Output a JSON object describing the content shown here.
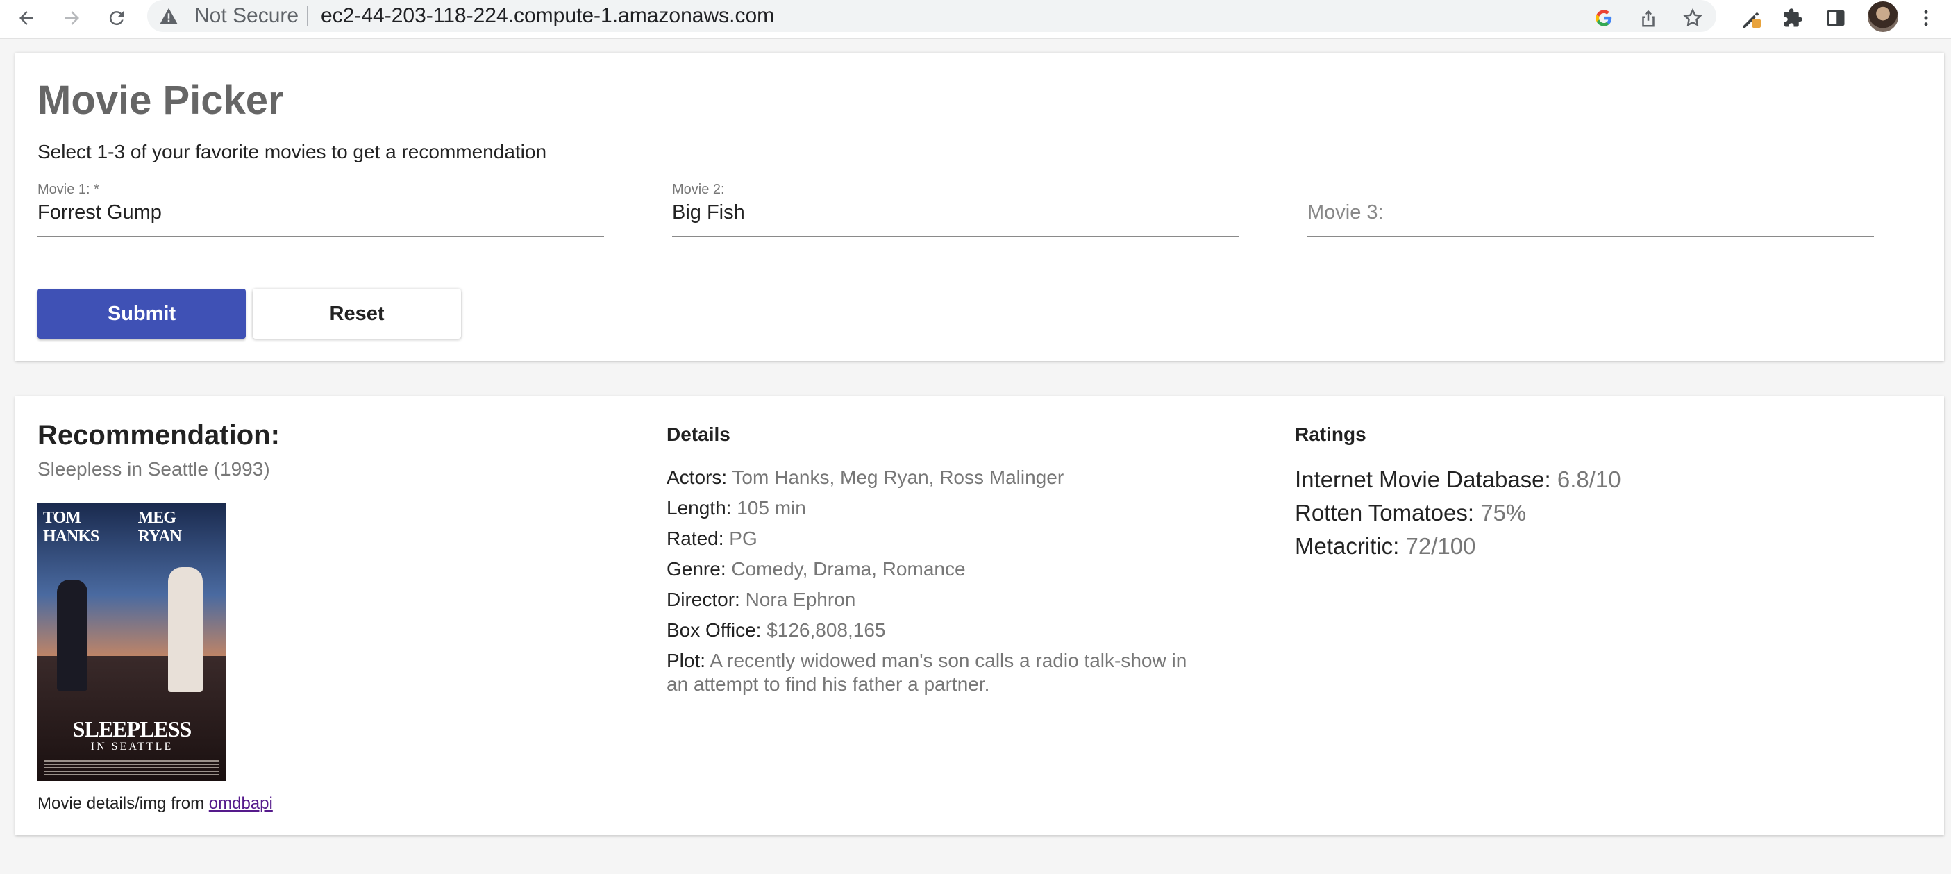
{
  "browser": {
    "security_label": "Not Secure",
    "url": "ec2-44-203-118-224.compute-1.amazonaws.com"
  },
  "form": {
    "title": "Movie Picker",
    "subtitle": "Select 1-3 of your favorite movies to get a recommendation",
    "fields": [
      {
        "label": "Movie 1:  *",
        "value": "Forrest Gump",
        "placeholder": ""
      },
      {
        "label": "Movie 2:",
        "value": "Big Fish",
        "placeholder": ""
      },
      {
        "label": "",
        "value": "",
        "placeholder": "Movie 3:"
      }
    ],
    "submit_label": "Submit",
    "reset_label": "Reset"
  },
  "recommendation": {
    "heading": "Recommendation:",
    "movie": "Sleepless in Seattle (1993)",
    "poster": {
      "names_left": "TOM HANKS",
      "names_right": "MEG RYAN",
      "title": "SLEEPLESS",
      "subtitle": "IN SEATTLE"
    },
    "source_prefix": "Movie details/img from ",
    "source_link": "omdbapi"
  },
  "details": {
    "heading": "Details",
    "items": [
      {
        "key": "Actors:",
        "value": "Tom Hanks, Meg Ryan, Ross Malinger"
      },
      {
        "key": "Length:",
        "value": "105 min"
      },
      {
        "key": "Rated:",
        "value": "PG"
      },
      {
        "key": "Genre:",
        "value": "Comedy, Drama, Romance"
      },
      {
        "key": "Director:",
        "value": "Nora Ephron"
      },
      {
        "key": "Box Office:",
        "value": "$126,808,165"
      },
      {
        "key": "Plot:",
        "value": "A recently widowed man's son calls a radio talk-show in an attempt to find his father a partner."
      }
    ]
  },
  "ratings": {
    "heading": "Ratings",
    "items": [
      {
        "key": "Internet Movie Database:",
        "value": "6.8/10"
      },
      {
        "key": "Rotten Tomatoes:",
        "value": "75%"
      },
      {
        "key": "Metacritic:",
        "value": "72/100"
      }
    ]
  },
  "colors": {
    "primary": "#3f51b5",
    "muted_text": "#777777",
    "title_text": "#666666",
    "link": "#551a8b"
  }
}
